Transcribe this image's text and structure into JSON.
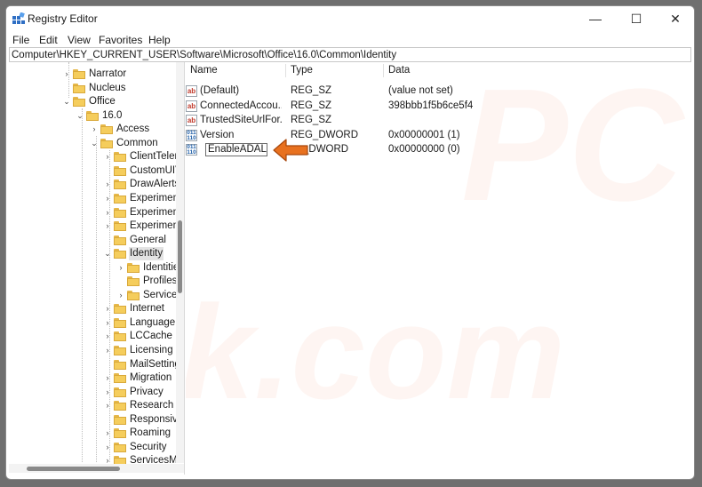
{
  "window": {
    "title": "Registry Editor",
    "controls": {
      "minimize": "—",
      "maximize": "☐",
      "close": "✕"
    }
  },
  "menu": [
    "File",
    "Edit",
    "View",
    "Favorites",
    "Help"
  ],
  "address": "Computer\\HKEY_CURRENT_USER\\Software\\Microsoft\\Office\\16.0\\Common\\Identity",
  "tree": [
    {
      "label": "Narrator",
      "depth": 0,
      "expander": "›"
    },
    {
      "label": "Nucleus",
      "depth": 0,
      "expander": ""
    },
    {
      "label": "Office",
      "depth": 0,
      "expander": "⌄"
    },
    {
      "label": "16.0",
      "depth": 1,
      "expander": "⌄"
    },
    {
      "label": "Access",
      "depth": 2,
      "expander": "›"
    },
    {
      "label": "Common",
      "depth": 2,
      "expander": "⌄"
    },
    {
      "label": "ClientTelem",
      "depth": 3,
      "expander": "›"
    },
    {
      "label": "CustomUIV",
      "depth": 3,
      "expander": ""
    },
    {
      "label": "DrawAlerts",
      "depth": 3,
      "expander": "›"
    },
    {
      "label": "Experiment",
      "depth": 3,
      "expander": "›"
    },
    {
      "label": "Experiment",
      "depth": 3,
      "expander": "›"
    },
    {
      "label": "Experiment",
      "depth": 3,
      "expander": "›"
    },
    {
      "label": "General",
      "depth": 3,
      "expander": ""
    },
    {
      "label": "Identity",
      "depth": 3,
      "expander": "⌄",
      "selected": true
    },
    {
      "label": "Identitie",
      "depth": 4,
      "expander": "›"
    },
    {
      "label": "Profiles",
      "depth": 4,
      "expander": ""
    },
    {
      "label": "ServiceA",
      "depth": 4,
      "expander": "›"
    },
    {
      "label": "Internet",
      "depth": 3,
      "expander": "›"
    },
    {
      "label": "LanguageR",
      "depth": 3,
      "expander": "›"
    },
    {
      "label": "LCCache",
      "depth": 3,
      "expander": "›"
    },
    {
      "label": "Licensing",
      "depth": 3,
      "expander": "›"
    },
    {
      "label": "MailSetting",
      "depth": 3,
      "expander": ""
    },
    {
      "label": "Migration",
      "depth": 3,
      "expander": "›"
    },
    {
      "label": "Privacy",
      "depth": 3,
      "expander": "›"
    },
    {
      "label": "Research",
      "depth": 3,
      "expander": "›"
    },
    {
      "label": "Responsive",
      "depth": 3,
      "expander": ""
    },
    {
      "label": "Roaming",
      "depth": 3,
      "expander": "›"
    },
    {
      "label": "Security",
      "depth": 3,
      "expander": "›"
    },
    {
      "label": "ServicesMa",
      "depth": 3,
      "expander": "›"
    }
  ],
  "columns": {
    "name": "Name",
    "type": "Type",
    "data": "Data"
  },
  "values": [
    {
      "icon": "ab",
      "name": "(Default)",
      "type": "REG_SZ",
      "data": "(value not set)"
    },
    {
      "icon": "ab",
      "name": "ConnectedAccou...",
      "type": "REG_SZ",
      "data": "398bbb1f5b6ce5f4"
    },
    {
      "icon": "ab",
      "name": "TrustedSiteUrlFor...",
      "type": "REG_SZ",
      "data": ""
    },
    {
      "icon": "dword",
      "name": "Version",
      "type": "REG_DWORD",
      "data": "0x00000001 (1)"
    },
    {
      "icon": "dword",
      "name": "",
      "type": "_DWORD",
      "data": "0x00000000 (0)",
      "editing": true
    }
  ],
  "rename_value": "EnableADAL",
  "watermark": {
    "top": "PC",
    "bottom": "risk.com"
  },
  "colors": {
    "accent_arrow": "#e8711f",
    "folder": "#f5cd5c",
    "selection": "#e3e3e3"
  }
}
